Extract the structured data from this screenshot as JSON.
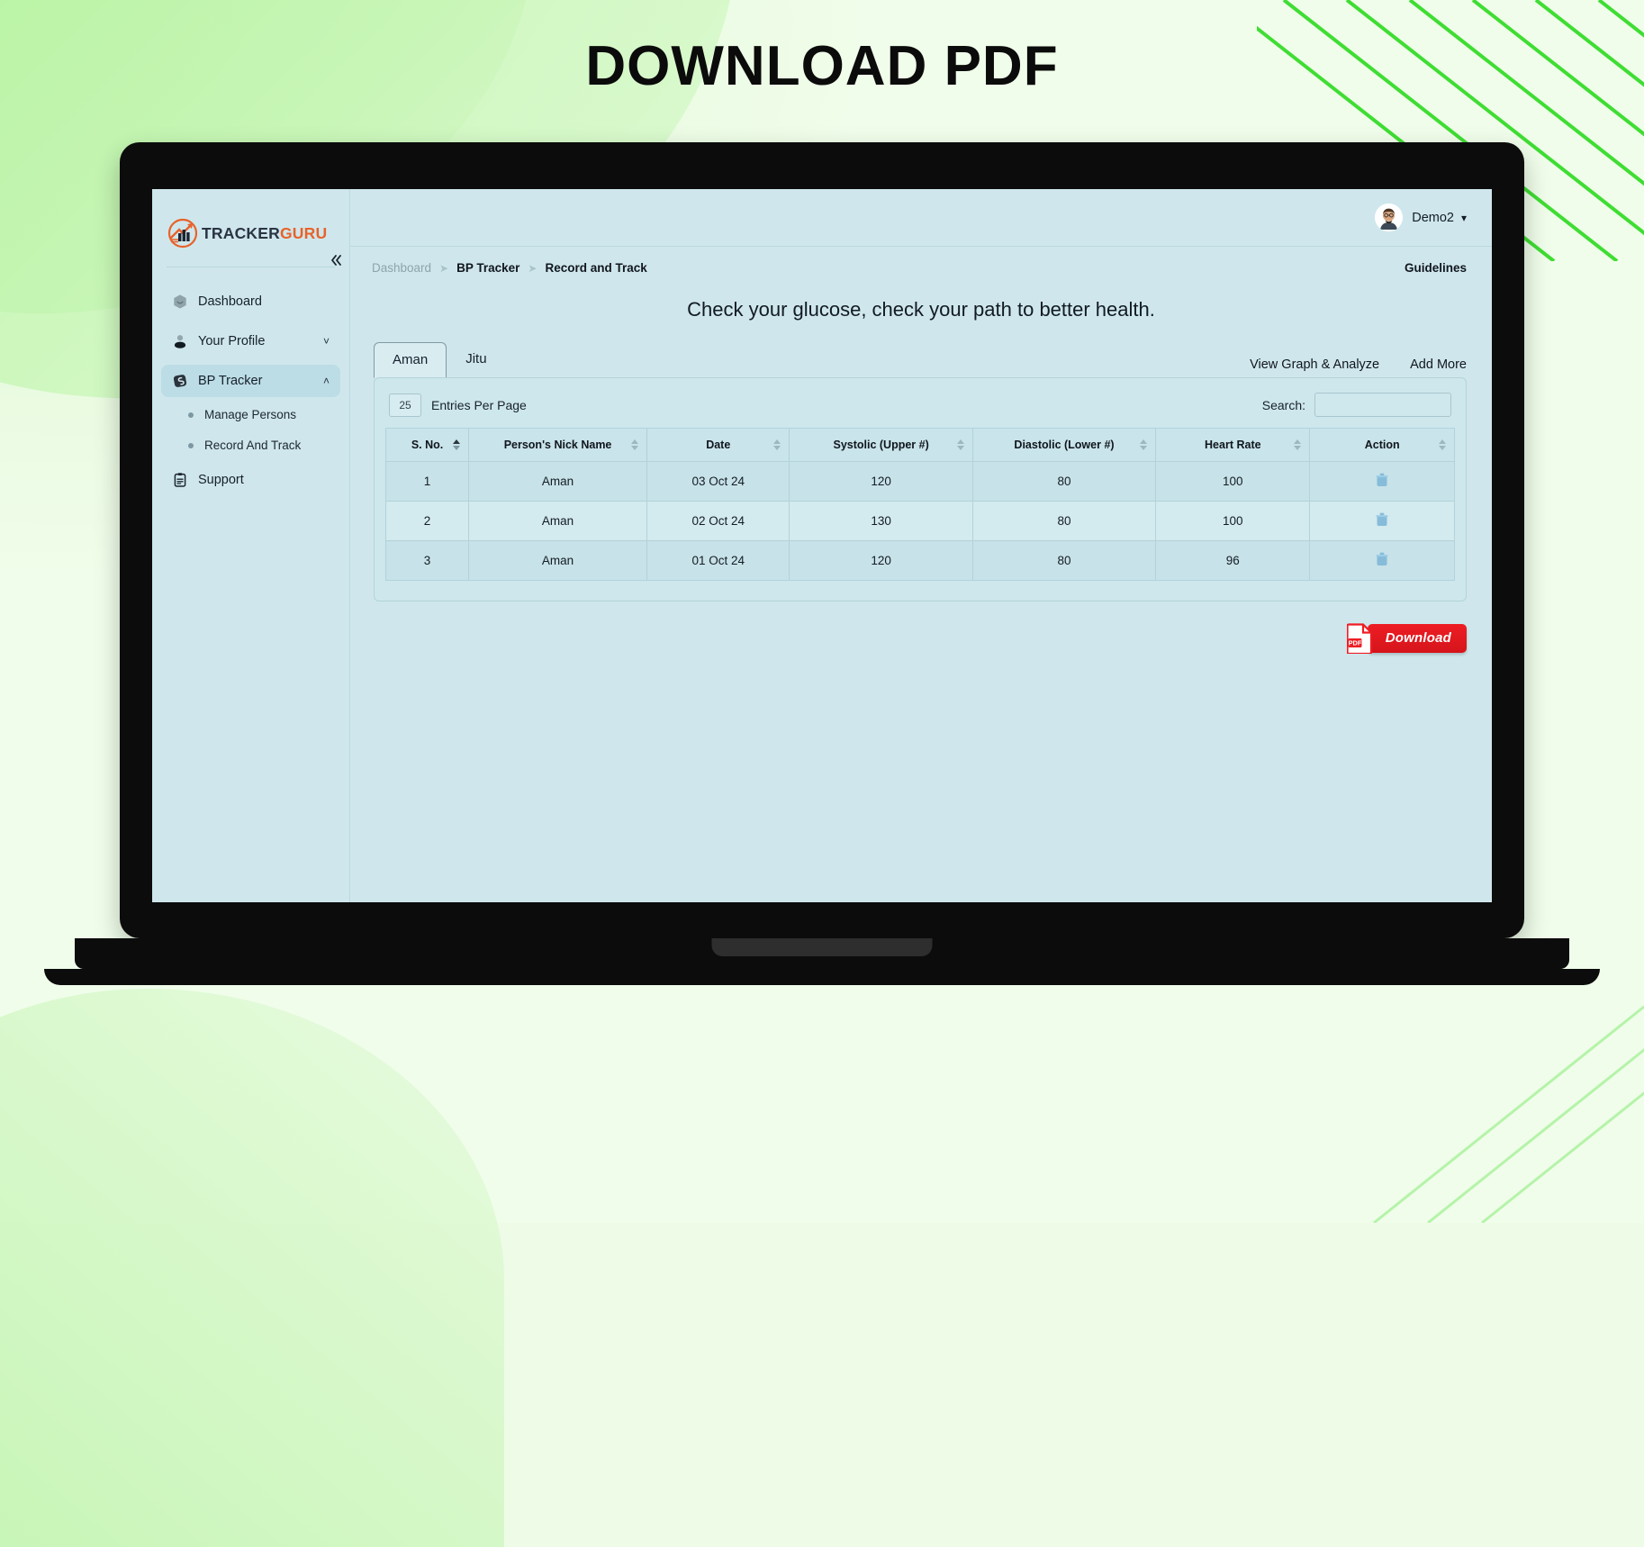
{
  "poster": {
    "title": "DOWNLOAD PDF",
    "accent_green": "#3fdd33",
    "bg_green": "#eefbe6"
  },
  "app": {
    "brand": {
      "name_part1": "TRACKER",
      "name_part2": "GURU",
      "logo_icon": "chart-arrow-logo"
    },
    "sidebar": {
      "collapse_icon": "chevron-left-double-icon",
      "items": [
        {
          "label": "Dashboard",
          "icon": "dashboard-icon",
          "active": false,
          "chevron": ""
        },
        {
          "label": "Your Profile",
          "icon": "user-icon",
          "active": false,
          "chevron": "˅"
        },
        {
          "label": "BP Tracker",
          "icon": "bp-tracker-icon",
          "active": true,
          "chevron": "˄"
        }
      ],
      "subitems": [
        {
          "label": "Manage Persons"
        },
        {
          "label": "Record And Track"
        }
      ],
      "support": {
        "label": "Support",
        "icon": "clipboard-icon"
      }
    },
    "topbar": {
      "user_name": "Demo2",
      "caret_icon": "chevron-down-icon",
      "avatar_icon": "user-avatar"
    },
    "breadcrumb": {
      "items": [
        {
          "label": "Dashboard",
          "muted": true
        },
        {
          "label": "BP Tracker",
          "muted": false
        },
        {
          "label": "Record and Track",
          "muted": false
        }
      ],
      "separator": "➤",
      "guidelines_label": "Guidelines"
    },
    "headline": "Check your glucose, check your path to better health.",
    "tabs": [
      {
        "label": "Aman",
        "active": true
      },
      {
        "label": "Jitu",
        "active": false
      }
    ],
    "tab_actions": [
      {
        "label": "View Graph & Analyze"
      },
      {
        "label": "Add More"
      }
    ],
    "table_controls": {
      "entries_value": "25",
      "entries_label": "Entries Per Page",
      "search_label": "Search:",
      "search_value": "",
      "search_placeholder": ""
    },
    "table": {
      "columns": [
        {
          "label": "S. No.",
          "sorted": true
        },
        {
          "label": "Person's Nick Name",
          "sorted": false
        },
        {
          "label": "Date",
          "sorted": false
        },
        {
          "label": "Systolic (Upper #)",
          "sorted": false
        },
        {
          "label": "Diastolic (Lower #)",
          "sorted": false
        },
        {
          "label": "Heart Rate",
          "sorted": false
        },
        {
          "label": "Action",
          "sorted": false
        }
      ],
      "rows": [
        {
          "sno": "1",
          "nick": "Aman",
          "date": "03 Oct 24",
          "systolic": "120",
          "diastolic": "80",
          "heart_rate": "100",
          "action_icon": "trash-icon"
        },
        {
          "sno": "2",
          "nick": "Aman",
          "date": "02 Oct 24",
          "systolic": "130",
          "diastolic": "80",
          "heart_rate": "100",
          "action_icon": "trash-icon"
        },
        {
          "sno": "3",
          "nick": "Aman",
          "date": "01 Oct 24",
          "systolic": "120",
          "diastolic": "80",
          "heart_rate": "96",
          "action_icon": "trash-icon"
        }
      ]
    },
    "download": {
      "label": "Download",
      "icon": "pdf-file-icon",
      "icon_badge": "PDF",
      "color": "#ee1d24"
    }
  }
}
